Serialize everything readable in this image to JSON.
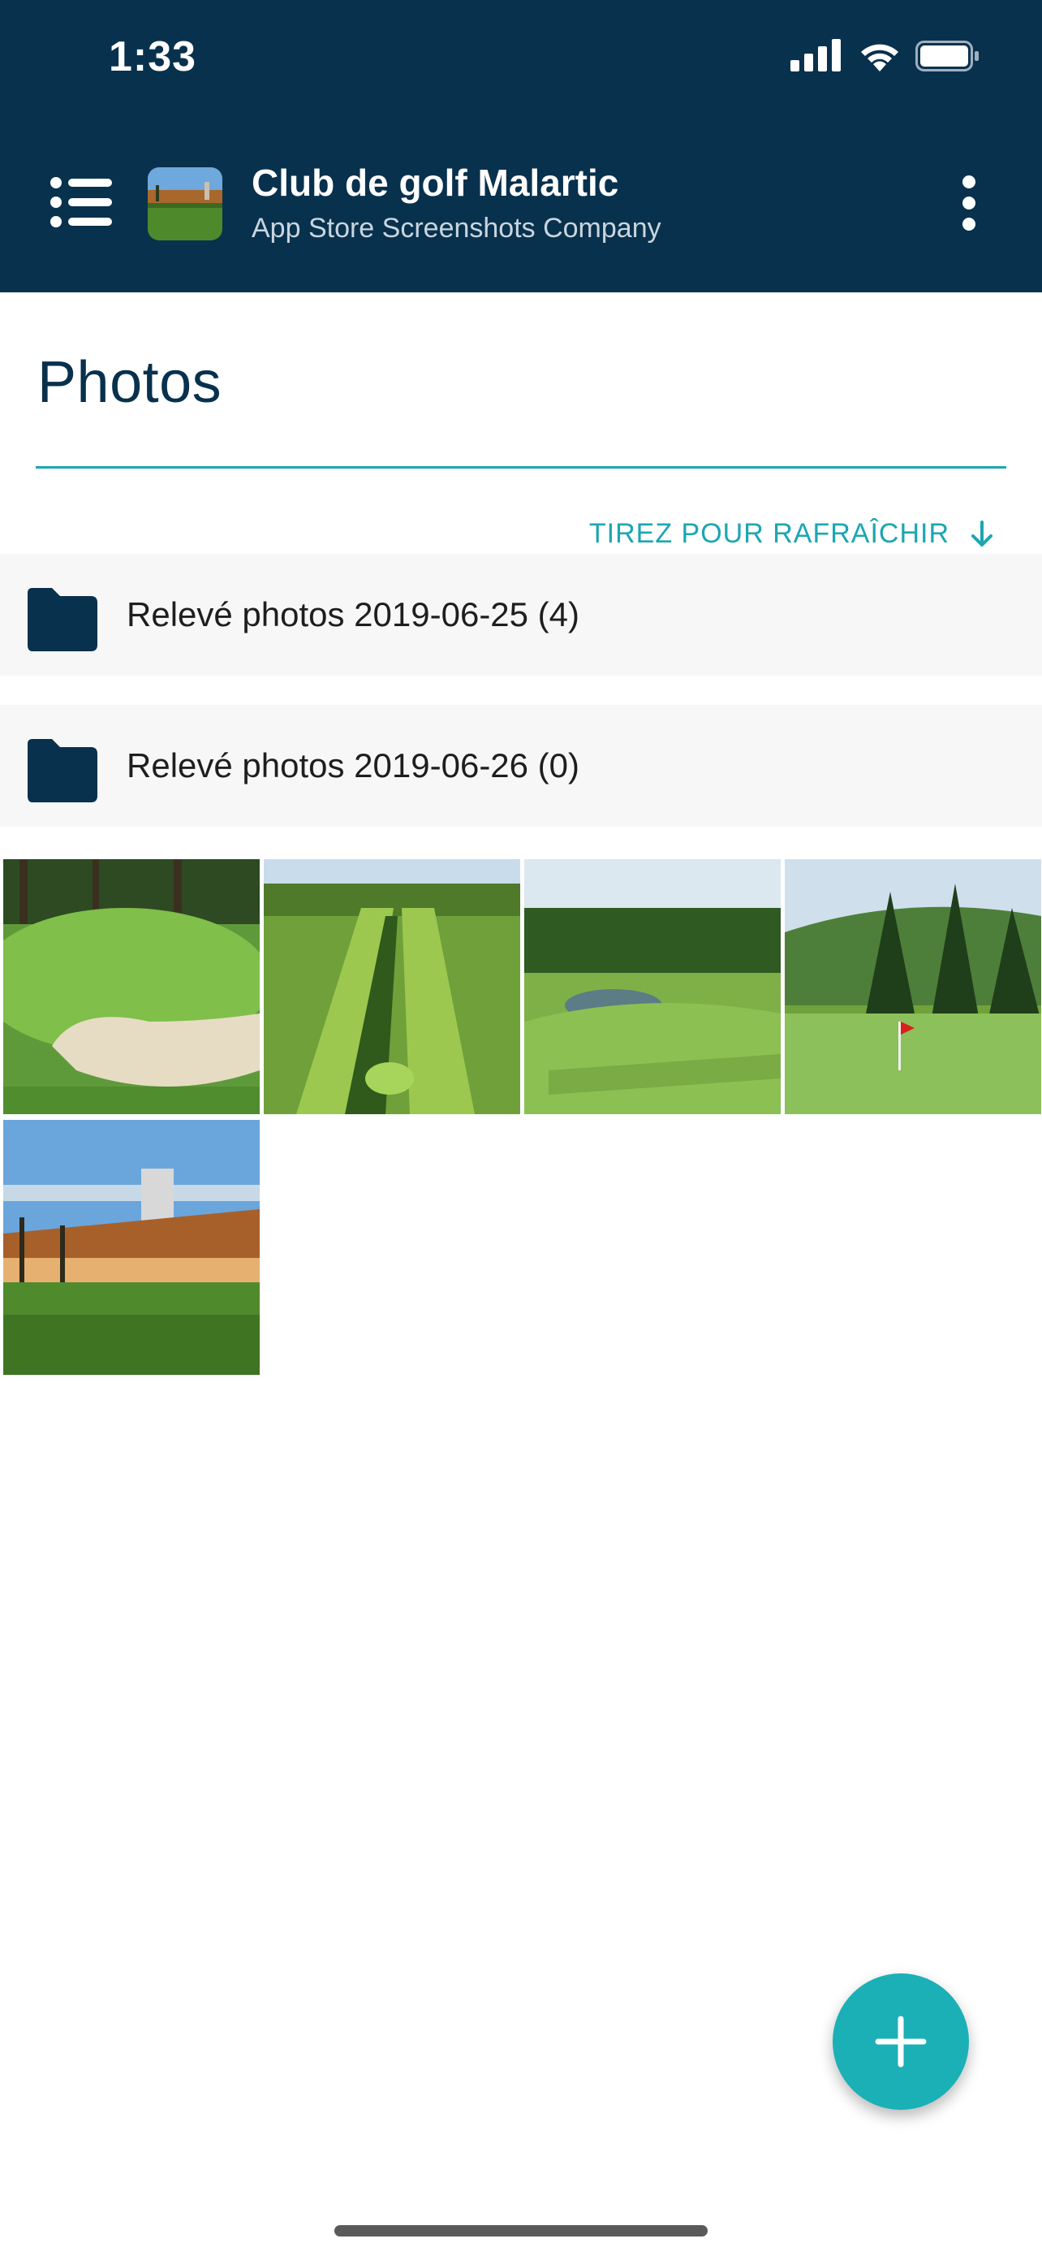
{
  "status_bar": {
    "time": "1:33"
  },
  "header": {
    "title": "Club de golf Malartic",
    "subtitle": "App Store Screenshots Company"
  },
  "page": {
    "title": "Photos",
    "refresh_label": "TIREZ POUR RAFRAÎCHIR"
  },
  "folders": [
    {
      "label": "Relevé photos 2019-06-25 (4)"
    },
    {
      "label": "Relevé photos 2019-06-26 (0)"
    }
  ],
  "photos": [
    {
      "icon": "golf-bunker-photo"
    },
    {
      "icon": "golf-aerial-photo"
    },
    {
      "icon": "golf-pond-photo"
    },
    {
      "icon": "golf-flag-photo"
    },
    {
      "icon": "golf-clubhouse-photo"
    }
  ],
  "colors": {
    "header_bg": "#08314d",
    "accent": "#1ab0b6",
    "title_text": "#08314d"
  }
}
